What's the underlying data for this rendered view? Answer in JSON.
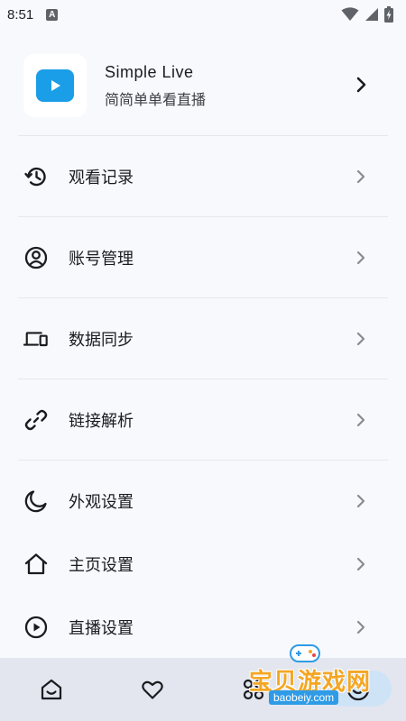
{
  "status_bar": {
    "time": "8:51",
    "notification_letter": "A"
  },
  "profile": {
    "app_name": "Simple Live",
    "subtitle": "简简单单看直播"
  },
  "menu": [
    {
      "label": "观看记录",
      "icon": "history-icon"
    },
    {
      "label": "账号管理",
      "icon": "account-circle-icon"
    },
    {
      "label": "数据同步",
      "icon": "devices-icon"
    },
    {
      "label": "链接解析",
      "icon": "link-icon"
    },
    {
      "label": "外观设置",
      "icon": "moon-icon"
    },
    {
      "label": "主页设置",
      "icon": "home-icon"
    },
    {
      "label": "直播设置",
      "icon": "play-circle-icon"
    }
  ],
  "bottom_nav": {
    "items": [
      "home-icon",
      "heart-icon",
      "category-icon",
      "user-icon"
    ],
    "active_index": 3
  },
  "watermark": {
    "text": "宝贝游戏网",
    "url": "baobeiy.com"
  },
  "colors": {
    "background": "#f8f9fd",
    "accent": "#1a9ee8",
    "nav_background": "#e3e6ef"
  }
}
